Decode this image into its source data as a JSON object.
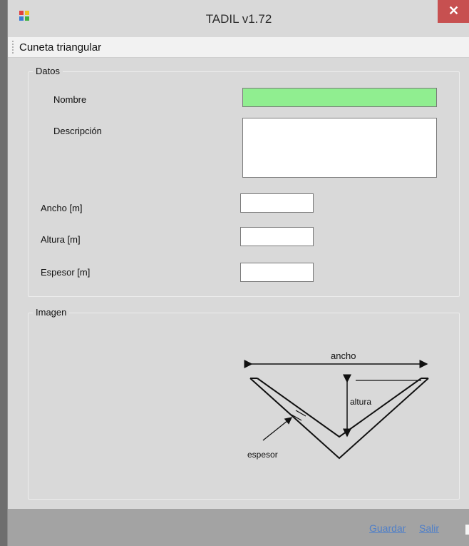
{
  "window": {
    "title": "TADIL v1.72",
    "close_glyph": "✕",
    "app_icon": "app-grid-icon"
  },
  "menu": {
    "items": [
      "Cuneta triangular"
    ]
  },
  "datos": {
    "legend": "Datos",
    "nombre_label": "Nombre",
    "descripcion_label": "Descripción",
    "ancho_label": "Ancho [m]",
    "altura_label": "Altura [m]",
    "espesor_label": "Espesor [m]",
    "nombre_value": "",
    "descripcion_value": "",
    "ancho_value": "",
    "altura_value": "",
    "espesor_value": "",
    "nombre_bg": "#90EE90"
  },
  "imagen": {
    "legend": "Imagen",
    "diagram": {
      "ancho": "ancho",
      "altura": "altura",
      "espesor": "espesor"
    }
  },
  "footer": {
    "guardar": "Guardar",
    "salir": "Salir",
    "link_color": "#4F7FC8"
  }
}
